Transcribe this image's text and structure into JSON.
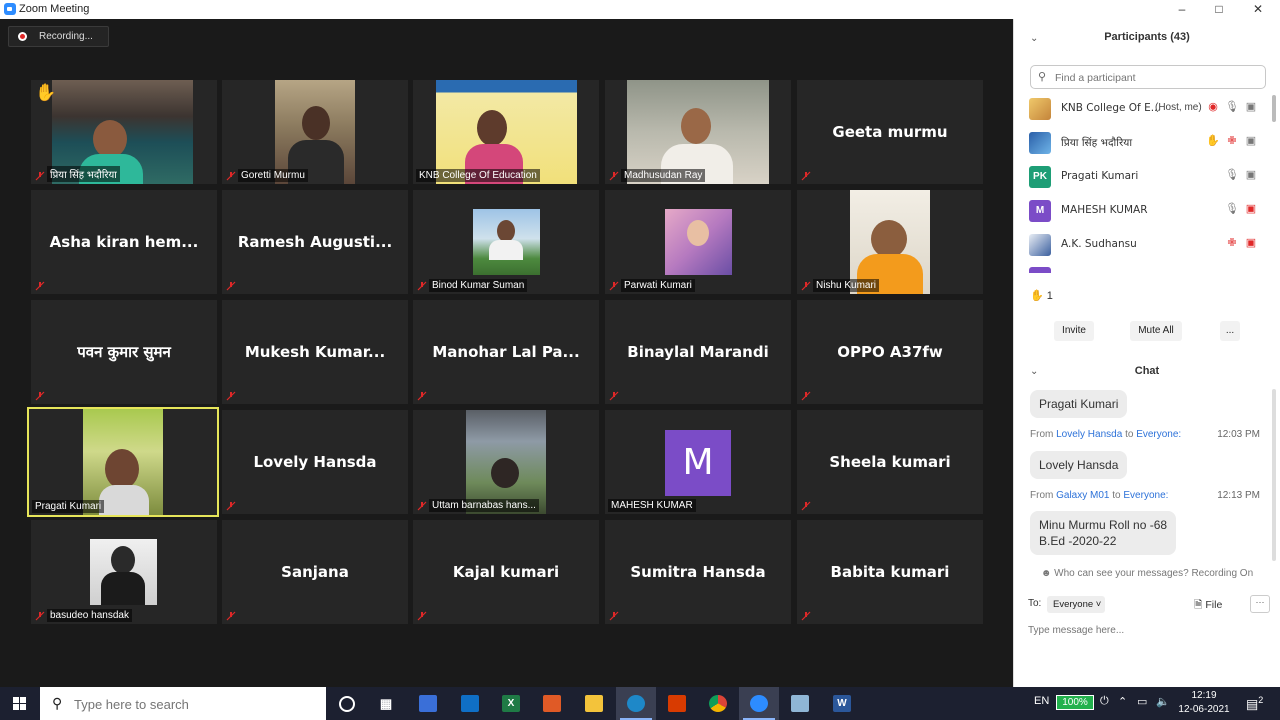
{
  "window": {
    "title": "Zoom Meeting",
    "minimize": "–",
    "maximize": "□",
    "close": "✕"
  },
  "recording": {
    "label": "Recording..."
  },
  "tiles": {
    "t0": {
      "name": "प्रिया सिंह भदौरिया",
      "hand": "✋"
    },
    "t1": {
      "name": "Goretti Murmu"
    },
    "t2": {
      "name": "KNB College Of Education"
    },
    "t3": {
      "name": "Madhusudan Ray"
    },
    "t4": {
      "center": "Geeta murmu"
    },
    "t5": {
      "center": "Asha kiran hem..."
    },
    "t6": {
      "center": "Ramesh Augusti..."
    },
    "t7": {
      "name": "Binod Kumar Suman"
    },
    "t8": {
      "name": "Parwati Kumari"
    },
    "t9": {
      "name": "Nishu Kumari"
    },
    "t10": {
      "center": "पवन कुमार सुमन"
    },
    "t11": {
      "center": "Mukesh Kumar..."
    },
    "t12": {
      "center": "Manohar Lal Pa..."
    },
    "t13": {
      "center": "Binaylal Marandi"
    },
    "t14": {
      "center": "OPPO A37fw"
    },
    "t15": {
      "name": "Pragati Kumari"
    },
    "t16": {
      "center": "Lovely Hansda"
    },
    "t17": {
      "name": "Uttam barnabas hans..."
    },
    "t18": {
      "name": "MAHESH KUMAR",
      "avatar": "M"
    },
    "t19": {
      "center": "Sheela kumari"
    },
    "t20": {
      "name": "basudeo hansdak"
    },
    "t21": {
      "center": "Sanjana"
    },
    "t22": {
      "center": "Kajal kumari"
    },
    "t23": {
      "center": "Sumitra Hansda"
    },
    "t24": {
      "center": "Babita kumari"
    }
  },
  "participants": {
    "title": "Participants (43)",
    "search_placeholder": "Find a participant",
    "list": [
      {
        "name": "KNB College Of E...",
        "host": "(Host, me)",
        "avatar": ""
      },
      {
        "name": "प्रिया सिंह भदौरिया",
        "avatar": ""
      },
      {
        "name": "Pragati Kumari",
        "avatar": "PK"
      },
      {
        "name": "MAHESH KUMAR",
        "avatar": "M"
      },
      {
        "name": "A.K. Sudhansu",
        "avatar": ""
      }
    ],
    "hand_count": "1",
    "buttons": {
      "invite": "Invite",
      "mute_all": "Mute All",
      "more": "..."
    }
  },
  "chat": {
    "title": "Chat",
    "messages": [
      {
        "from": "",
        "to": "",
        "time": "",
        "text": "Pragati Kumari"
      },
      {
        "from": "Lovely Hansda",
        "to": "Everyone:",
        "time": "12:03 PM",
        "text": "Lovely Hansda"
      },
      {
        "from": "Galaxy M01",
        "to": "Everyone:",
        "time": "12:13 PM",
        "text": "Minu Murmu Roll no -68",
        "text2": "B.Ed  -2020-22"
      }
    ],
    "from_word": "From",
    "to_word": "to",
    "privacy": "Who can see your messages? Recording On",
    "to_label": "To:",
    "to_value": "Everyone",
    "file_label": "File",
    "more": "···",
    "input_placeholder": "Type message here..."
  },
  "taskbar": {
    "search_placeholder": "Type here to search",
    "lang": "EN",
    "battery": "100%",
    "time": "12:19",
    "date": "12-06-2021",
    "notifications": "2"
  },
  "colors": {
    "tile_bg": "#262626",
    "video_bg": "#1a1a1a",
    "muted_red": "#e02828",
    "link_blue": "#2d72d9",
    "speaker_outline": "#e6e55a",
    "avatar_purple": "#7b4cc7",
    "pk_green": "#1e9e76"
  }
}
